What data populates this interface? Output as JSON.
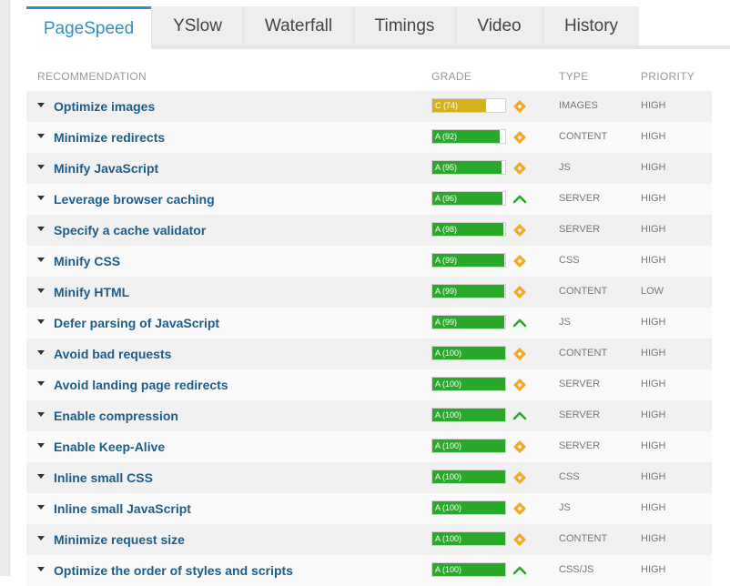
{
  "tabs": [
    {
      "label": "PageSpeed",
      "active": true
    },
    {
      "label": "YSlow",
      "active": false
    },
    {
      "label": "Waterfall",
      "active": false
    },
    {
      "label": "Timings",
      "active": false
    },
    {
      "label": "Video",
      "active": false
    },
    {
      "label": "History",
      "active": false
    }
  ],
  "table": {
    "headers": {
      "recommendation": "RECOMMENDATION",
      "grade": "GRADE",
      "type": "TYPE",
      "priority": "PRIORITY"
    },
    "rows": [
      {
        "name": "Optimize images",
        "grade": "C (74)",
        "score": 74,
        "trend": "diamond-icon",
        "type": "IMAGES",
        "priority": "HIGH"
      },
      {
        "name": "Minimize redirects",
        "grade": "A (92)",
        "score": 92,
        "trend": "diamond-icon",
        "type": "CONTENT",
        "priority": "HIGH"
      },
      {
        "name": "Minify JavaScript",
        "grade": "A (95)",
        "score": 95,
        "trend": "diamond-icon",
        "type": "JS",
        "priority": "HIGH"
      },
      {
        "name": "Leverage browser caching",
        "grade": "A (96)",
        "score": 96,
        "trend": "up-arrow-icon",
        "type": "SERVER",
        "priority": "HIGH"
      },
      {
        "name": "Specify a cache validator",
        "grade": "A (98)",
        "score": 98,
        "trend": "diamond-icon",
        "type": "SERVER",
        "priority": "HIGH"
      },
      {
        "name": "Minify CSS",
        "grade": "A (99)",
        "score": 99,
        "trend": "diamond-icon",
        "type": "CSS",
        "priority": "HIGH"
      },
      {
        "name": "Minify HTML",
        "grade": "A (99)",
        "score": 99,
        "trend": "diamond-icon",
        "type": "CONTENT",
        "priority": "LOW"
      },
      {
        "name": "Defer parsing of JavaScript",
        "grade": "A (99)",
        "score": 99,
        "trend": "up-arrow-icon",
        "type": "JS",
        "priority": "HIGH"
      },
      {
        "name": "Avoid bad requests",
        "grade": "A (100)",
        "score": 100,
        "trend": "diamond-icon",
        "type": "CONTENT",
        "priority": "HIGH"
      },
      {
        "name": "Avoid landing page redirects",
        "grade": "A (100)",
        "score": 100,
        "trend": "diamond-icon",
        "type": "SERVER",
        "priority": "HIGH"
      },
      {
        "name": "Enable compression",
        "grade": "A (100)",
        "score": 100,
        "trend": "up-arrow-icon",
        "type": "SERVER",
        "priority": "HIGH"
      },
      {
        "name": "Enable Keep-Alive",
        "grade": "A (100)",
        "score": 100,
        "trend": "diamond-icon",
        "type": "SERVER",
        "priority": "HIGH"
      },
      {
        "name": "Inline small CSS",
        "grade": "A (100)",
        "score": 100,
        "trend": "diamond-icon",
        "type": "CSS",
        "priority": "HIGH"
      },
      {
        "name": "Inline small JavaScript",
        "grade": "A (100)",
        "score": 100,
        "trend": "diamond-icon",
        "type": "JS",
        "priority": "HIGH"
      },
      {
        "name": "Minimize request size",
        "grade": "A (100)",
        "score": 100,
        "trend": "diamond-icon",
        "type": "CONTENT",
        "priority": "HIGH"
      },
      {
        "name": "Optimize the order of styles and scripts",
        "grade": "A (100)",
        "score": 100,
        "trend": "up-arrow-icon",
        "type": "CSS/JS",
        "priority": "HIGH"
      }
    ]
  },
  "colors": {
    "accent": "#2f8fc9",
    "grade_a": "#2aa82a",
    "grade_c": "#d4b21a",
    "diamond": "#f5a623",
    "up_arrow": "#2aa82a",
    "link": "#1d5d8a"
  }
}
